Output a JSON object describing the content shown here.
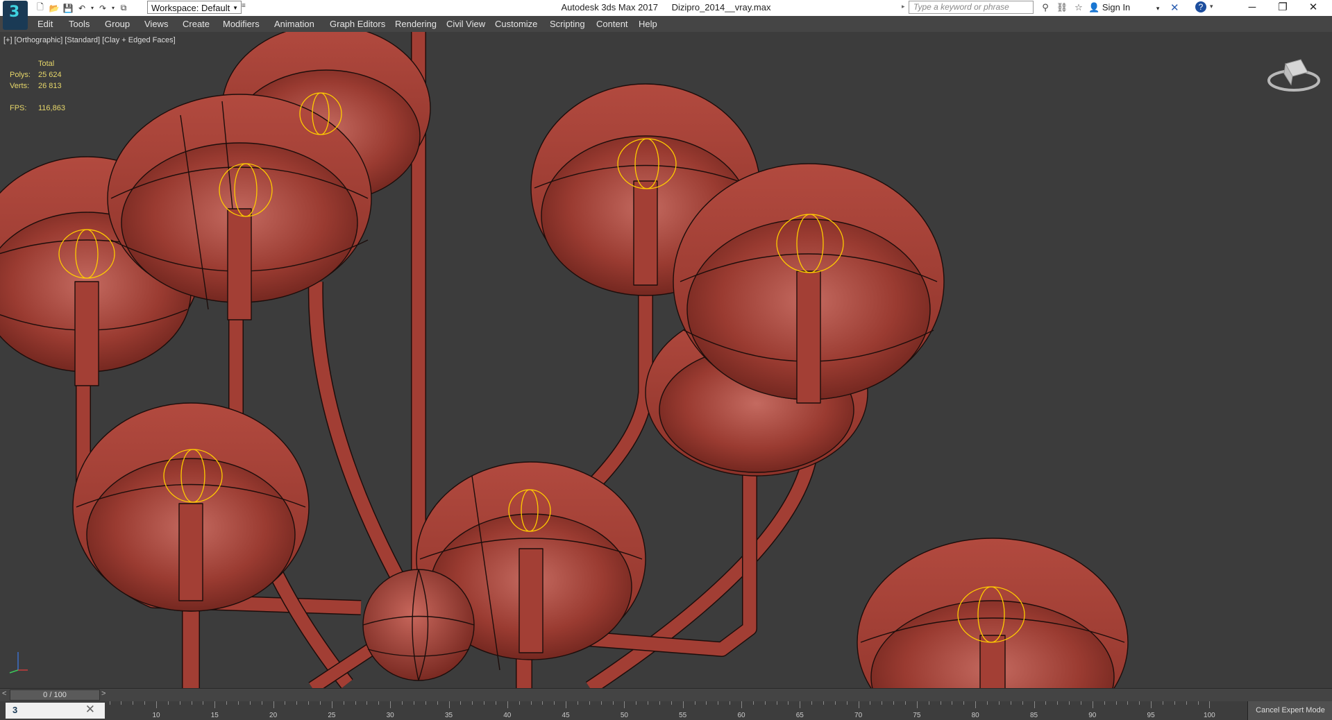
{
  "app": {
    "title": "Autodesk 3ds Max 2017",
    "filename": "Dizipro_2014__vray.max",
    "logo_text": "3"
  },
  "quick_access": {
    "icons": [
      "new-file-icon",
      "open-file-icon",
      "save-icon",
      "undo-icon",
      "redo-icon",
      "project-folder-icon"
    ],
    "workspace_label": "Workspace: Default"
  },
  "infocenter": {
    "search_placeholder": "Type a keyword or phrase",
    "sign_in": "Sign In",
    "icons": [
      "binoculars-icon",
      "star-subscription-icon",
      "favorites-star-icon"
    ]
  },
  "window_controls": {
    "minimize": "─",
    "restore": "❐",
    "close": "✕"
  },
  "menu": [
    "Edit",
    "Tools",
    "Group",
    "Views",
    "Create",
    "Modifiers",
    "Animation",
    "Graph Editors",
    "Rendering",
    "Civil View",
    "Customize",
    "Scripting",
    "Content",
    "Help"
  ],
  "viewport": {
    "label": "[+] [Orthographic] [Standard] [Clay + Edged Faces]",
    "stats": {
      "header": "Total",
      "polys_label": "Polys:",
      "polys_value": "25 624",
      "verts_label": "Verts:",
      "verts_value": "26 813",
      "fps_label": "FPS:",
      "fps_value": "116,863"
    },
    "colors": {
      "background": "#3c3c3c",
      "model": "#a03c32",
      "edges": "#1a0f0d",
      "selection": "#ffcc00"
    }
  },
  "timeline": {
    "frame": "0 / 100",
    "ruler_labels": [
      "10",
      "15",
      "20",
      "25",
      "30",
      "35",
      "40",
      "45",
      "50",
      "55",
      "60",
      "65",
      "70",
      "75",
      "80",
      "85",
      "90",
      "95",
      "100"
    ]
  },
  "status": {
    "cancel_expert": "Cancel Expert Mode"
  }
}
